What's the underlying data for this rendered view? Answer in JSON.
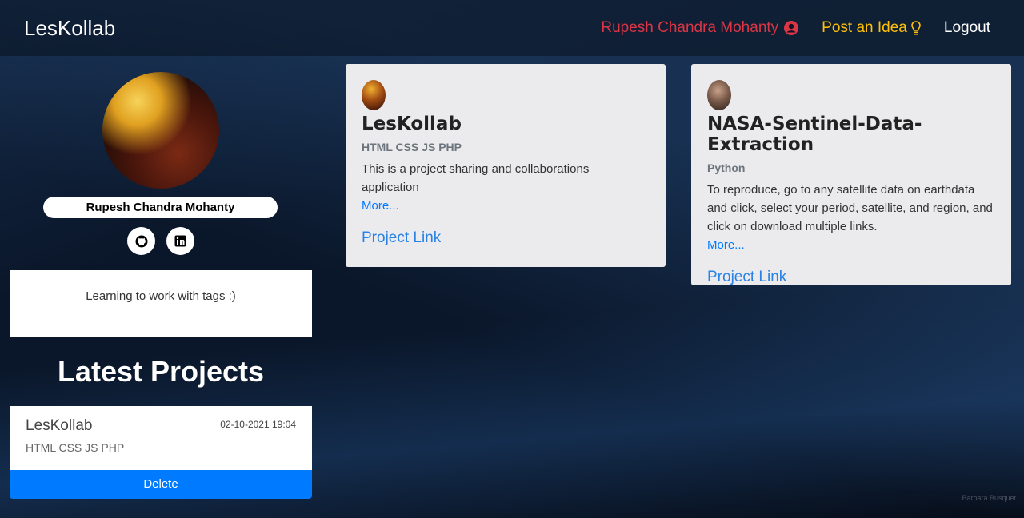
{
  "nav": {
    "brand": "LesKollab",
    "user_name": "Rupesh Chandra Mohanty",
    "post_idea": "Post an Idea",
    "logout": "Logout"
  },
  "profile": {
    "name": "Rupesh Chandra Mohanty",
    "bio": "Learning to work with tags :)",
    "social": [
      "github-icon",
      "linkedin-icon"
    ]
  },
  "latest": {
    "heading": "Latest Projects",
    "project": {
      "title": "LesKollab",
      "tags": "HTML CSS JS PHP",
      "date": "02-10-2021 19:04",
      "delete_label": "Delete"
    }
  },
  "ideas": [
    {
      "title": "LesKollab",
      "tags": "HTML CSS JS PHP",
      "desc": "This is a project sharing and collaborations application",
      "more": "More...",
      "link": "Project Link"
    },
    {
      "title": "NASA-Sentinel-Data-Extraction",
      "tags": "Python",
      "desc": "To reproduce, go to any satellite data on earthdata and click, select your period, satellite, and region, and click on download multiple links.",
      "more": "More...",
      "link": "Project Link"
    }
  ],
  "watermark": "Barbara Busquet",
  "colors": {
    "user": "#dc3545",
    "post": "#ffc107",
    "primary": "#007bff"
  }
}
